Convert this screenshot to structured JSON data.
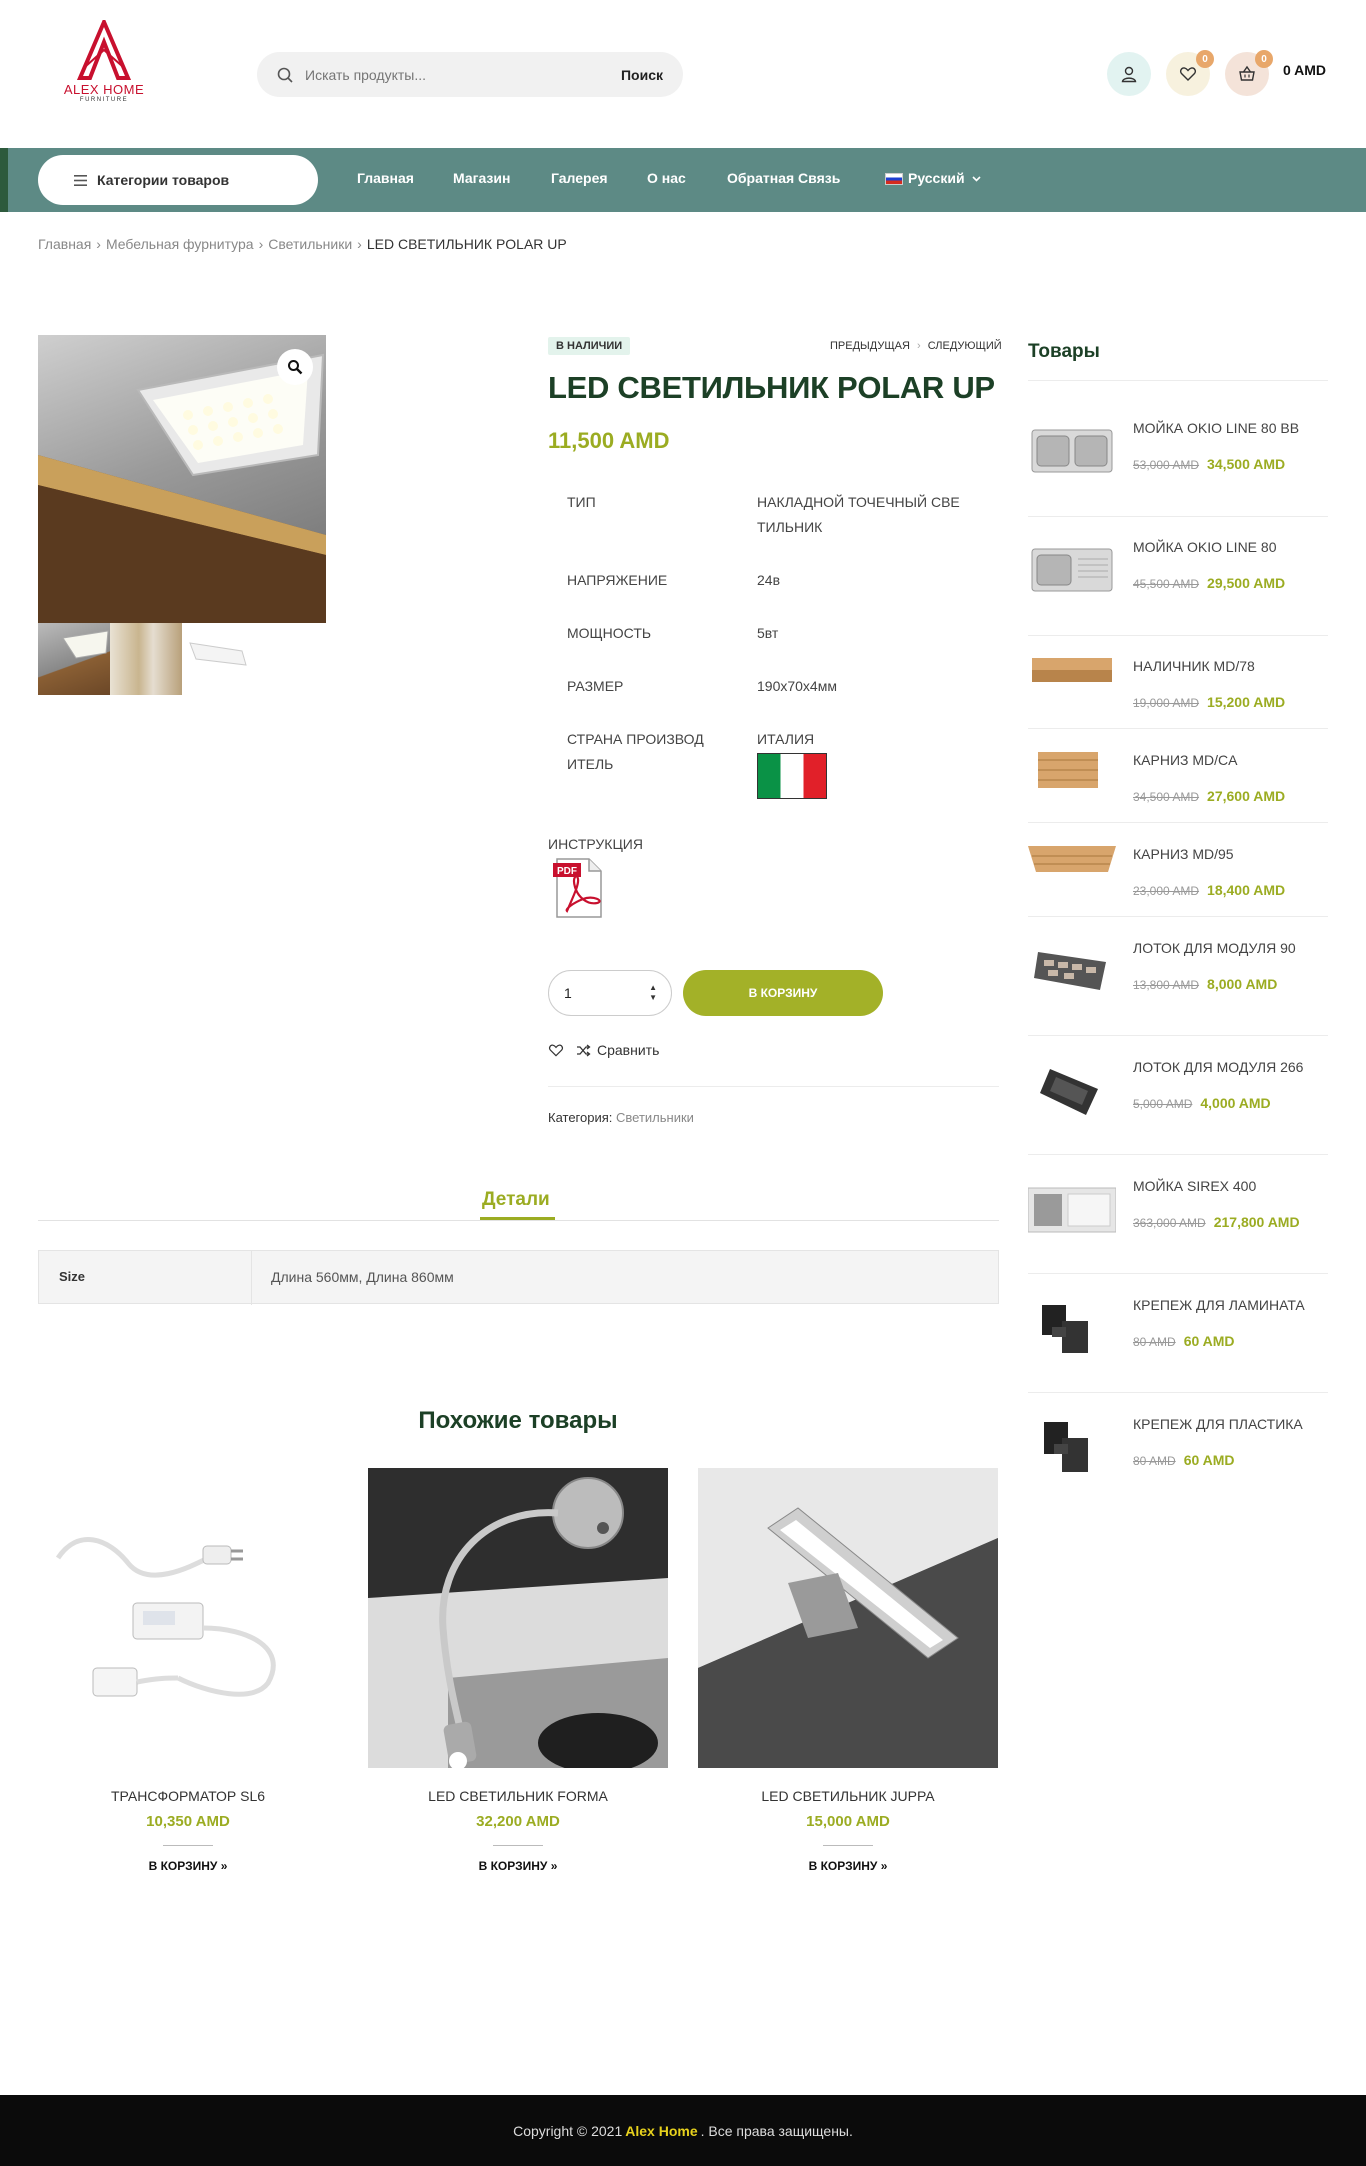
{
  "header": {
    "logo_text": "ALEX HOME",
    "logo_sub": "FURNITURE",
    "search_placeholder": "Искать продукты...",
    "search_button": "Поиск",
    "wishlist_count": "0",
    "cart_count": "0",
    "cart_total": "0 AMD"
  },
  "nav": {
    "categories_label": "Категории товаров",
    "items": [
      "Главная",
      "Магазин",
      "Галерея",
      "О нас",
      "Обратная Связь"
    ],
    "language": "Русский"
  },
  "breadcrumb": {
    "items": [
      "Главная",
      "Мебельная фурнитура",
      "Светильники"
    ],
    "current": "LED СВЕТИЛЬНИК POLAR UP"
  },
  "product": {
    "stock": "В НАЛИЧИИ",
    "prev": "ПРЕДЫДУЩАЯ",
    "next": "СЛЕДУЮЩИЙ",
    "title": "LED СВЕТИЛЬНИК POLAR UP",
    "price": "11,500 AMD",
    "attributes": [
      {
        "label": "ТИП",
        "value": "НАКЛАДНОЙ ТОЧЕЧНЫЙ СВЕ ТИЛЬНИК"
      },
      {
        "label": "НАПРЯЖЕНИЕ",
        "value": "24в"
      },
      {
        "label": "МОЩНОСТЬ",
        "value": "5вт"
      },
      {
        "label": "РАЗМЕР",
        "value": "190x70x4мм"
      },
      {
        "label": "СТРАНА ПРОИЗВОД ИТЕЛЬ",
        "value": "ИТАЛИЯ"
      }
    ],
    "instruction_label": "ИНСТРУКЦИЯ",
    "pdf_label": "PDF",
    "quantity": "1",
    "add_to_cart": "В КОРЗИНУ",
    "compare": "Сравнить",
    "category_label": "Категория:",
    "category_value": "Светильники"
  },
  "tabs": {
    "details": "Детали",
    "spec_key": "Size",
    "spec_value": "Длина 560мм, Длина 860мм"
  },
  "related": {
    "title": "Похожие товары",
    "buy_label": "В КОРЗИНУ »",
    "items": [
      {
        "name": "ТРАНСФОРМАТОР SL6",
        "price": "10,350 AMD"
      },
      {
        "name": "LED СВЕТИЛЬНИК FORMA",
        "price": "32,200 AMD"
      },
      {
        "name": "LED СВЕТИЛЬНИК JUPPA",
        "price": "15,000 AMD"
      }
    ]
  },
  "sidebar": {
    "title": "Товары",
    "items": [
      {
        "name": "МОЙКА OKIO LINE 80 BB",
        "old": "53,000 AMD",
        "new": "34,500 AMD"
      },
      {
        "name": "МОЙКА OKIO LINE 80",
        "old": "45,500 AMD",
        "new": "29,500 AMD"
      },
      {
        "name": "НАЛИЧНИК MD/78",
        "old": "19,000 AMD",
        "new": "15,200 AMD"
      },
      {
        "name": "КАРНИЗ MD/CA",
        "old": "34,500 AMD",
        "new": "27,600 AMD"
      },
      {
        "name": "КАРНИЗ MD/95",
        "old": "23,000 AMD",
        "new": "18,400 AMD"
      },
      {
        "name": "ЛОТОК ДЛЯ МОДУЛЯ 90",
        "old": "13,800 AMD",
        "new": "8,000 AMD"
      },
      {
        "name": "ЛОТОК ДЛЯ МОДУЛЯ 266",
        "old": "5,000 AMD",
        "new": "4,000 AMD"
      },
      {
        "name": "МОЙКА SIREX 400",
        "old": "363,000 AMD",
        "new": "217,800 AMD"
      },
      {
        "name": "КРЕПЕЖ ДЛЯ ЛАМИНАТА",
        "old": "80 AMD",
        "new": "60 AMD"
      },
      {
        "name": "КРЕПЕЖ ДЛЯ ПЛАСТИКА",
        "old": "80 AMD",
        "new": "60 AMD"
      }
    ]
  },
  "footer": {
    "prefix": "Copyright © 2021",
    "brand": "Alex Home",
    "suffix": ". Все права защищены."
  },
  "colors": {
    "nav_bg": "#5d8a85",
    "accent_green": "#9bac22",
    "title_dark_green": "#1c4026",
    "footer_bg": "#0b0b0b"
  }
}
